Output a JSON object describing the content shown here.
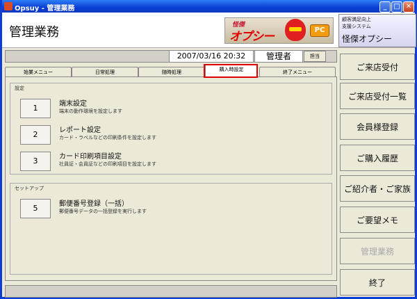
{
  "window": {
    "title": "Opsuy - 管理業務",
    "min_label": "_",
    "max_label": "□",
    "close_label": "✕"
  },
  "header": {
    "page_title": "管理業務",
    "logo": {
      "line1": "怪傑",
      "line2": "オプシー",
      "pc": "PC"
    },
    "system": {
      "line1": "顧客満足向上",
      "line2": "支援システム",
      "name": "怪傑オプシー"
    }
  },
  "infobar": {
    "datetime": "2007/03/16 20:32",
    "user": "管理者",
    "user_button": "担当"
  },
  "tabs": [
    {
      "label": "始業メニュー"
    },
    {
      "label": "日常処理"
    },
    {
      "label": "随時処理"
    },
    {
      "label": "購入時設定",
      "active": true
    },
    {
      "label": "終了メニュー"
    }
  ],
  "groups": {
    "settings": {
      "title": "設定",
      "items": [
        {
          "number": "1",
          "title": "端末設定",
          "desc": "端末の動作環境を設定します"
        },
        {
          "number": "2",
          "title": "レポート設定",
          "desc": "カード・ラベルなどの印刷条件を設定します"
        },
        {
          "number": "3",
          "title": "カード印刷項目設定",
          "desc": "社員証・会員証などの印刷項目を設定します"
        }
      ]
    },
    "setup": {
      "title": "セットアップ",
      "items": [
        {
          "number": "5",
          "title": "郵便番号登録（一括）",
          "desc": "郵便番号データの一括登録を実行します"
        }
      ]
    }
  },
  "sidebar": [
    {
      "label": "ご来店受付",
      "disabled": false
    },
    {
      "label": "ご来店受付一覧",
      "disabled": false
    },
    {
      "label": "会員様登録",
      "disabled": false
    },
    {
      "label": "ご購入履歴",
      "disabled": false
    },
    {
      "label": "ご紹介者・ご家族",
      "disabled": false
    },
    {
      "label": "ご要望メモ",
      "disabled": false
    },
    {
      "label": "管理業務",
      "disabled": true
    },
    {
      "label": "終了",
      "disabled": false
    }
  ],
  "colors": {
    "titlebar": "#0a3ed4",
    "highlight": "#e00000",
    "disabled_text": "#a9a9a9"
  }
}
